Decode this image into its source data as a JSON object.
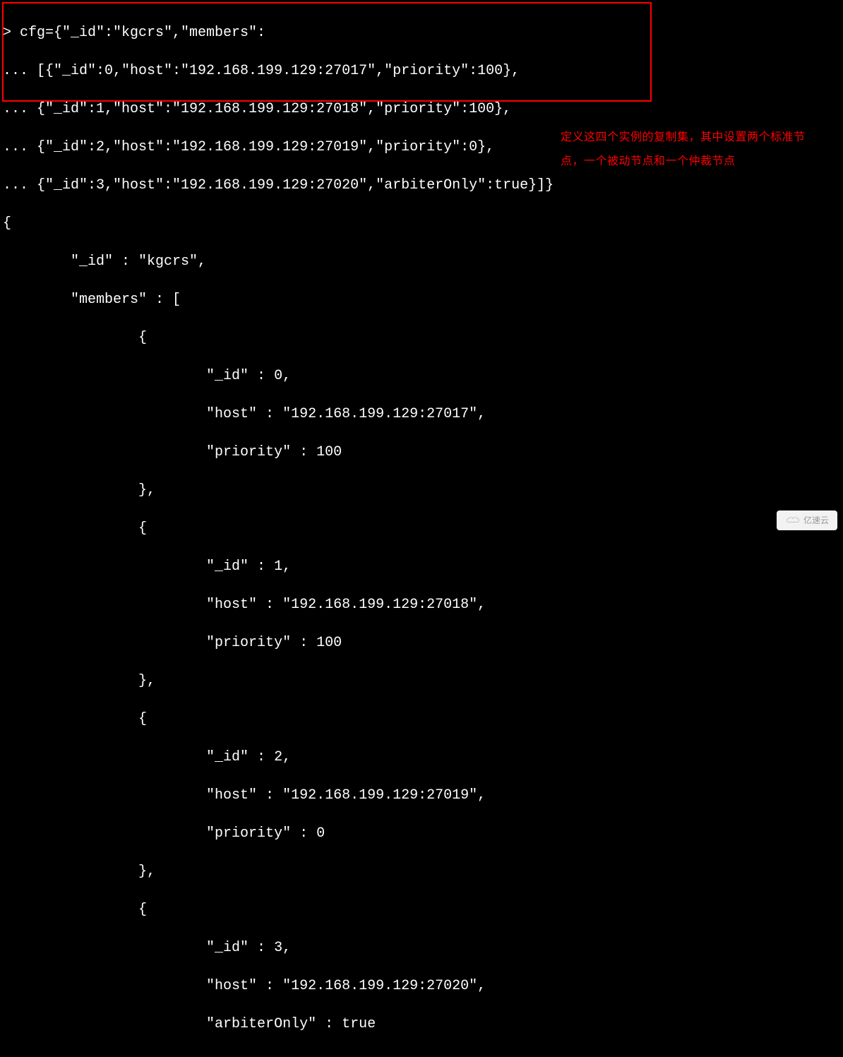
{
  "terminal": {
    "lines": [
      "> cfg={\"_id\":\"kgcrs\",\"members\":",
      "... [{\"_id\":0,\"host\":\"192.168.199.129:27017\",\"priority\":100},",
      "... {\"_id\":1,\"host\":\"192.168.199.129:27018\",\"priority\":100},",
      "... {\"_id\":2,\"host\":\"192.168.199.129:27019\",\"priority\":0},",
      "... {\"_id\":3,\"host\":\"192.168.199.129:27020\",\"arbiterOnly\":true}]}",
      "{",
      "        \"_id\" : \"kgcrs\",",
      "        \"members\" : [",
      "                {",
      "                        \"_id\" : 0,",
      "                        \"host\" : \"192.168.199.129:27017\",",
      "                        \"priority\" : 100",
      "                },",
      "                {",
      "                        \"_id\" : 1,",
      "                        \"host\" : \"192.168.199.129:27018\",",
      "                        \"priority\" : 100",
      "                },",
      "                {",
      "                        \"_id\" : 2,",
      "                        \"host\" : \"192.168.199.129:27019\",",
      "                        \"priority\" : 0",
      "                },",
      "                {",
      "                        \"_id\" : 3,",
      "                        \"host\" : \"192.168.199.129:27020\",",
      "                        \"arbiterOnly\" : true"
    ]
  },
  "annotation": {
    "line1": "定义这四个实例的复制集，其中设置两个标准节",
    "line2": "点，一个被动节点和一个仲裁节点"
  },
  "watermark": {
    "text": "亿速云"
  }
}
